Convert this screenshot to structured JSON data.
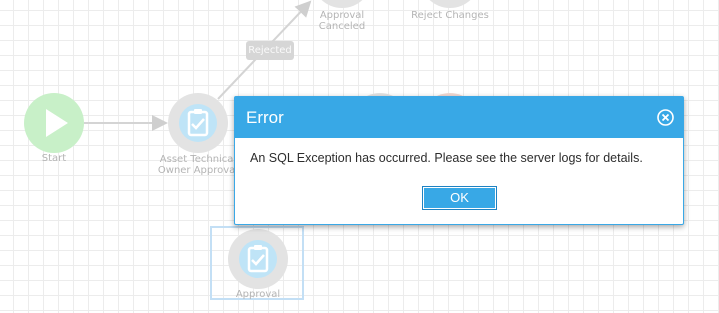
{
  "workflow": {
    "nodes": {
      "start": {
        "label": "Start"
      },
      "asset_owner_approval": {
        "label": "Asset Technical\nOwner Approval"
      },
      "approval_canceled": {
        "label": "Approval\nCanceled"
      },
      "reject_changes": {
        "label": "Reject Changes"
      },
      "approval": {
        "label": "Approval"
      }
    },
    "edges": {
      "rejected_label": "Rejected"
    }
  },
  "dialog": {
    "title": "Error",
    "message": "An SQL Exception has occurred. Please see the server logs for details.",
    "ok_label": "OK"
  },
  "colors": {
    "dialog_header": "#38a8e6",
    "start_node": "#c8f0c8",
    "task_node_inner": "#bfe4f7"
  },
  "icons": {
    "start": "play-icon",
    "task": "clipboard-check-icon",
    "close": "close-circle-icon"
  }
}
